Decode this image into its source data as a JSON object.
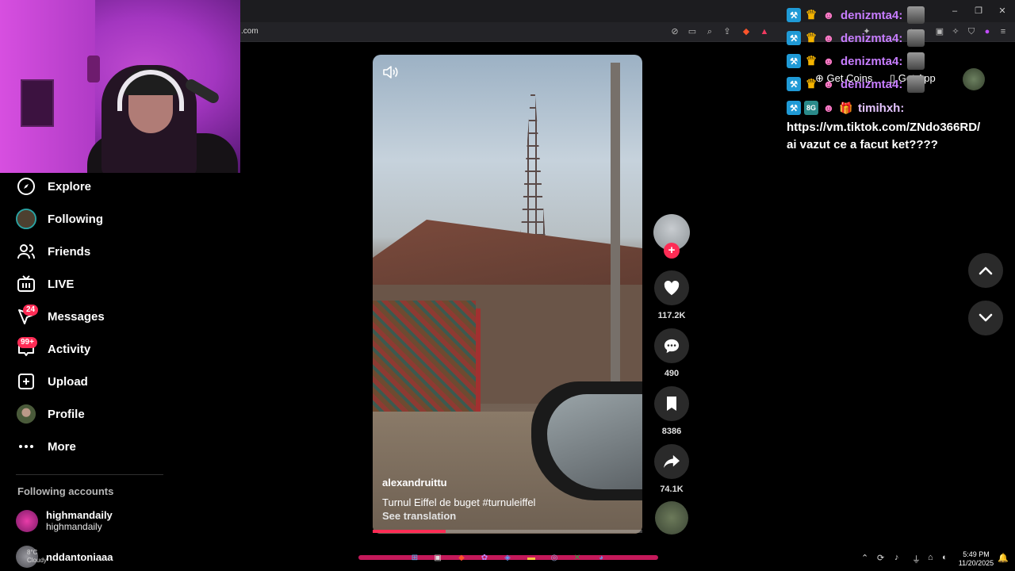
{
  "browser": {
    "url_fragment": ".com"
  },
  "sidebar": {
    "items": [
      {
        "label": "Explore",
        "icon": "compass-icon"
      },
      {
        "label": "Following",
        "icon": "following-avatar-icon"
      },
      {
        "label": "Friends",
        "icon": "friends-icon"
      },
      {
        "label": "LIVE",
        "icon": "live-icon"
      },
      {
        "label": "Messages",
        "icon": "messages-icon",
        "badge": "24"
      },
      {
        "label": "Activity",
        "icon": "activity-icon",
        "badge": "99+"
      },
      {
        "label": "Upload",
        "icon": "upload-icon"
      },
      {
        "label": "Profile",
        "icon": "profile-avatar-icon"
      },
      {
        "label": "More",
        "icon": "more-icon"
      }
    ],
    "following_header": "Following accounts",
    "accounts": [
      {
        "name": "highmandaily",
        "sub": "highmandaily"
      },
      {
        "name": "nddantoniaaa",
        "sub": ""
      }
    ]
  },
  "video": {
    "username": "alexandruittu",
    "caption": "Turnul Eiffel de buget #turnuleiffel",
    "see_translation": "See translation",
    "progress": 0.27
  },
  "actions": {
    "likes": "117.2K",
    "comments": "490",
    "saves": "8386",
    "shares": "74.1K"
  },
  "header": {
    "get_coins": "Get Coins",
    "get_app": "Get App"
  },
  "chat": {
    "lines": [
      {
        "user": "denizmta4:"
      },
      {
        "user": "denizmta4:"
      },
      {
        "user": "denizmta4:"
      },
      {
        "user": "denizmta4:"
      }
    ],
    "last_user": "timihxh:",
    "last_badge": "8G",
    "message_link": "https://vm.tiktok.com/ZNdo366RD/",
    "message_text": "ai vazut ce a facut ket????"
  },
  "system": {
    "weather": "8°C",
    "weather_desc": "Cloudy",
    "time": "5:49 PM",
    "date": "11/20/2025"
  },
  "colors": {
    "accent": "#fe2c55",
    "chat_user": "#c77dff",
    "mod_badge": "#1f9ad6"
  }
}
